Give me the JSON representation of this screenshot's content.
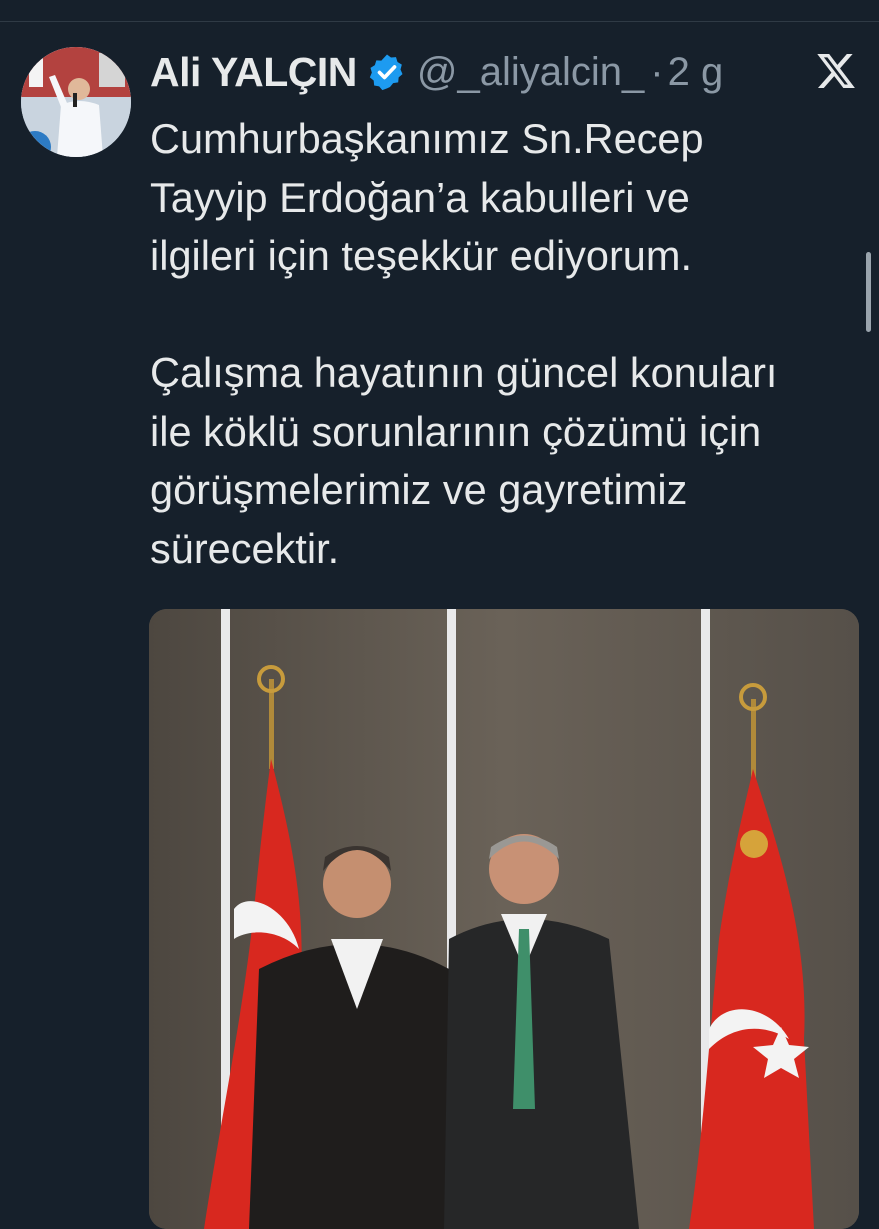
{
  "tweet": {
    "author_name": "Ali YALÇIN",
    "handle": "@_aliyalcin_",
    "separator": "·",
    "time": "2 g",
    "verified": true,
    "text": "Cumhurbaşkanımız Sn.Recep\nTayyip Erdoğan’a  kabulleri ve\nilgileri için teşekkür ediyorum.\n\nÇalışma hayatının güncel konuları\nile köklü sorunlarının çözümü için\ngörüşmelerimiz ve gayretimiz\nsürecektir."
  },
  "icons": {
    "verified": "verified-badge-icon",
    "platform": "x-logo-icon"
  },
  "colors": {
    "background": "#16202b",
    "text": "#e7e9ea",
    "muted": "#8b98a5",
    "verified_blue": "#1d9bf0",
    "flag_red": "#d8281f"
  }
}
